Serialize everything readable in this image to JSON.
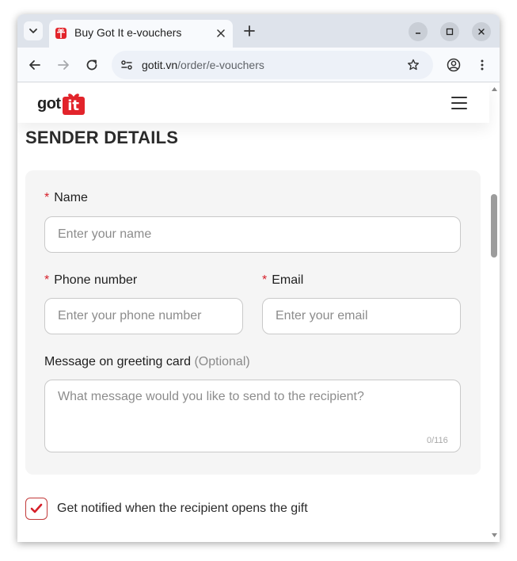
{
  "browser": {
    "tab": {
      "title": "Buy Got It e-vouchers"
    },
    "address": {
      "host": "gotit.vn",
      "path": "/order/e-vouchers"
    },
    "icons": [
      "tab-search-icon",
      "gift-favicon-icon",
      "close-icon",
      "plus-icon",
      "minimize-icon",
      "maximize-icon",
      "close-window-icon",
      "back-arrow-icon",
      "forward-arrow-icon",
      "reload-icon",
      "site-info-icon",
      "star-icon",
      "profile-icon",
      "kebab-menu-icon"
    ]
  },
  "site": {
    "logo_text": "got",
    "logo_badge": "it",
    "brand_color": "#e2242b",
    "icons": [
      "hamburger-menu-icon"
    ]
  },
  "form": {
    "section_title": "SENDER DETAILS",
    "name": {
      "required_mark": "*",
      "label": "Name",
      "placeholder": "Enter your name"
    },
    "phone": {
      "required_mark": "*",
      "label": "Phone number",
      "placeholder": "Enter your phone number"
    },
    "email": {
      "required_mark": "*",
      "label": "Email",
      "placeholder": "Enter your email"
    },
    "message": {
      "label": "Message on greeting card",
      "optional": "(Optional)",
      "placeholder": "What message would you like to send to the recipient?",
      "counter": "0/116"
    },
    "notify": {
      "label": "Get notified when the recipient opens the gift",
      "checked": true
    }
  }
}
